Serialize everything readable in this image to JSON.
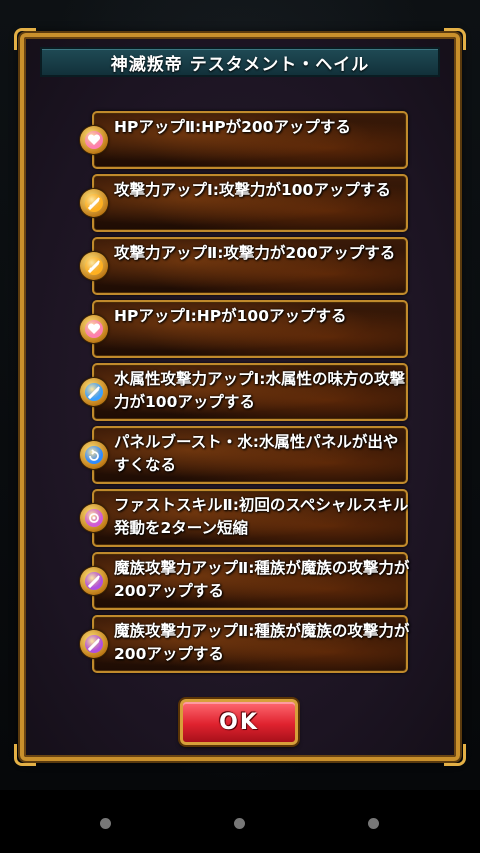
{
  "dialog": {
    "title": "神滅叛帝 テスタメント・ヘイル",
    "ok_label": "OK"
  },
  "skills": [
    {
      "text": "HPアップⅡ:HPが200アップする",
      "icon": "hp-heart-icon",
      "color": "#ff7fb0"
    },
    {
      "text": "攻撃力アップⅠ:攻撃力が100アップする",
      "icon": "attack-sword-icon",
      "color": "#ffb020"
    },
    {
      "text": "攻撃力アップⅡ:攻撃力が200アップする",
      "icon": "attack-sword-icon",
      "color": "#ffb020"
    },
    {
      "text": "HPアップⅠ:HPが100アップする",
      "icon": "hp-heart-icon",
      "color": "#ff7fb0"
    },
    {
      "text": "水属性攻撃力アップⅠ:水属性の味方の攻撃力が100アップする",
      "icon": "water-sword-icon",
      "color": "#3aa0ff"
    },
    {
      "text": "パネルブースト・水:水属性パネルが出やすくなる",
      "icon": "water-panel-icon",
      "color": "#2f8cff"
    },
    {
      "text": "ファストスキルⅡ:初回のスペシャルスキル発動を2ターン短縮",
      "icon": "fast-skill-icon",
      "color": "#d05ad8"
    },
    {
      "text": "魔族攻撃力アップⅡ:種族が魔族の攻撃力が200アップする",
      "icon": "demon-sword-icon",
      "color": "#b050e0"
    },
    {
      "text": "魔族攻撃力アップⅡ:種族が魔族の攻撃力が200アップする",
      "icon": "demon-sword-icon",
      "color": "#b050e0"
    }
  ]
}
